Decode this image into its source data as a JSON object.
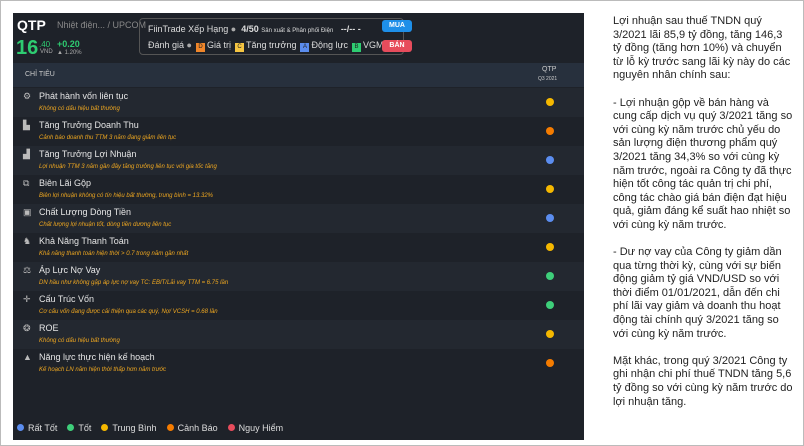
{
  "header": {
    "symbol": "QTP",
    "exchange": "Nhiệt điện... / UPCOM",
    "price": "16",
    "price_decimal": ".40",
    "currency": "VND",
    "change": "+0.20",
    "change_pct": "▲ 1.20%"
  },
  "rank": {
    "label": "FiinTrade Xếp Hạng",
    "rank": "4/50",
    "sector": "Sản xuất & Phân phối Điện",
    "extra": "--/-- -",
    "rating_label": "Đánh giá",
    "ratings": [
      {
        "grade": "D",
        "label": "Giá trị",
        "color": "#f0862a"
      },
      {
        "grade": "C",
        "label": "Tăng trưởng",
        "color": "#f5c542"
      },
      {
        "grade": "A",
        "label": "Động lực",
        "color": "#5b8def"
      },
      {
        "grade": "B",
        "label": "VGM",
        "color": "#2ecc71"
      }
    ]
  },
  "buttons": {
    "buy": "MUA",
    "sell": "BÁN"
  },
  "table": {
    "col_label": "CHỈ TIÊU",
    "col_symbol": "QTP",
    "col_period": "Q3 2021",
    "rows": [
      {
        "icon": "⚙",
        "title": "Phát hành vốn liên tục",
        "note": "Không có dấu hiệu bất thường",
        "color": "#f5b800"
      },
      {
        "icon": "▙",
        "title": "Tăng Trưởng Doanh Thu",
        "note": "Cảnh báo doanh thu TTM 3 năm đang giảm liên tục",
        "color": "#f57c00"
      },
      {
        "icon": "▟",
        "title": "Tăng Trưởng Lợi Nhuận",
        "note": "Lợi nhuận TTM 3 năm gần đây tăng trưởng liên tục với gia tốc tăng",
        "color": "#5b8def"
      },
      {
        "icon": "⧉",
        "title": "Biên Lãi Gộp",
        "note": "Biên lợi nhuận không có tín hiệu bất thường, trung bình = 13.32%",
        "color": "#f5b800"
      },
      {
        "icon": "▣",
        "title": "Chất Lượng Dòng Tiền",
        "note": "Chất lượng lợi nhuận tốt, dòng tiền dương liên tục",
        "color": "#5b8def"
      },
      {
        "icon": "♞",
        "title": "Khả Năng Thanh Toán",
        "note": "Khả năng thanh toán hiện thời > 0.7 trong năm gần nhất",
        "color": "#f5b800"
      },
      {
        "icon": "⚖",
        "title": "Áp Lực Nợ Vay",
        "note": "DN hầu như không gặp áp lực nợ vay TC: EBIT/Lãi vay TTM = 6.75 lần",
        "color": "#3ecf7a"
      },
      {
        "icon": "✛",
        "title": "Cấu Trúc Vốn",
        "note": "Cơ cấu vốn đang được cải thiện qua các quý, Nợ/ VCSH = 0.68 lần",
        "color": "#3ecf7a"
      },
      {
        "icon": "❂",
        "title": "ROE",
        "note": "Không có dấu hiệu bất thường",
        "color": "#f5b800"
      },
      {
        "icon": "▲",
        "title": "Năng lực thực hiện kế hoạch",
        "note": "Kế hoạch LN năm hiện thời thấp hơn năm trước",
        "color": "#f57c00"
      }
    ]
  },
  "legend": [
    {
      "label": "Rất Tốt",
      "color": "#5b8def"
    },
    {
      "label": "Tốt",
      "color": "#3ecf7a"
    },
    {
      "label": "Trung Bình",
      "color": "#f5b800"
    },
    {
      "label": "Cảnh Báo",
      "color": "#f57c00"
    },
    {
      "label": "Nguy Hiểm",
      "color": "#e74c5c"
    }
  ],
  "commentary": "Lợi nhuận sau thuế TNDN quý 3/2021 lãi 85,9 tỷ đồng, tăng 146,3 tỷ đồng (tăng hơn 10%) và chuyển từ lỗ kỳ trước sang lãi kỳ này do các nguyên nhân chính sau:\n\n- Lợi nhuận gộp về bán hàng và cung cấp dịch vụ quý 3/2021 tăng so với cùng kỳ năm trước chủ yếu do sản lượng điện thương phẩm quý 3/2021 tăng 34,3% so với cùng kỳ năm trước, ngoài ra Công ty đã thực hiện tốt công tác quản trị chi phí, công tác chào giá bán điện đạt hiệu quả, giảm đáng kể suất hao nhiệt so với cùng kỳ năm trước.\n\n- Dư nợ vay của Công ty giảm dần qua từng thời kỳ, cùng với sự biến động giảm tỷ giá VND/USD so với thời điểm 01/01/2021, dẫn đến chi phí lãi vay giảm và doanh thu hoạt động tài chính quý 3/2021 tăng so với cùng kỳ năm trước.\n\nMặt khác, trong quý 3/2021 Công ty ghi nhận chi phí thuế TNDN tăng 5,6 tỷ đồng so với cùng kỳ năm trước do lợi nhuận tăng."
}
